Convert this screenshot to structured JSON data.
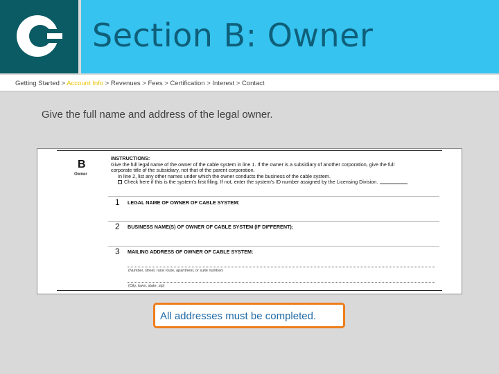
{
  "header": {
    "title": "Section B: Owner"
  },
  "breadcrumb": {
    "items": [
      {
        "label": "Getting Started",
        "active": false
      },
      {
        "label": "Account Info",
        "active": true
      },
      {
        "label": "Revenues",
        "active": false
      },
      {
        "label": "Fees",
        "active": false
      },
      {
        "label": "Certification",
        "active": false
      },
      {
        "label": "Interest",
        "active": false
      },
      {
        "label": "Contact",
        "active": false
      }
    ],
    "separator": " > "
  },
  "main": {
    "instruction": "Give the full name and address of the legal owner.",
    "form": {
      "section_letter": "B",
      "section_word": "Owner",
      "instructions_heading": "INSTRUCTIONS:",
      "instructions_line1": "Give the full legal name of the owner of the cable system in line 1. If the owner is a subsidiary of another corporation, give the full",
      "instructions_line2": "corporate title of the subsidiary, not that of the parent corporation.",
      "instructions_line3": "In line 2, list any other names under which the owner conducts the business of the cable system.",
      "instructions_line4": "Check here if this is the system's first filing. If not, enter the system's ID number assigned by the Licensing Division.",
      "line1_num": "1",
      "line1_label": "LEGAL NAME OF OWNER OF CABLE SYSTEM:",
      "line2_num": "2",
      "line2_label": "BUSINESS NAME(S) OF OWNER OF CABLE SYSTEM (IF DIFFERENT):",
      "line3_num": "3",
      "line3_label": "MAILING ADDRESS OF OWNER OF CABLE SYSTEM:",
      "address_caption1": "(Number, street, rural route, apartment, or suite number)",
      "address_caption2": "(City, town, state, zip)"
    },
    "notice": "All addresses must be completed."
  },
  "colors": {
    "header_bar": "#36c3f0",
    "logo_box": "#0a5b63",
    "active_crumb": "#e8c200",
    "notice_border": "#ee7d1b"
  }
}
